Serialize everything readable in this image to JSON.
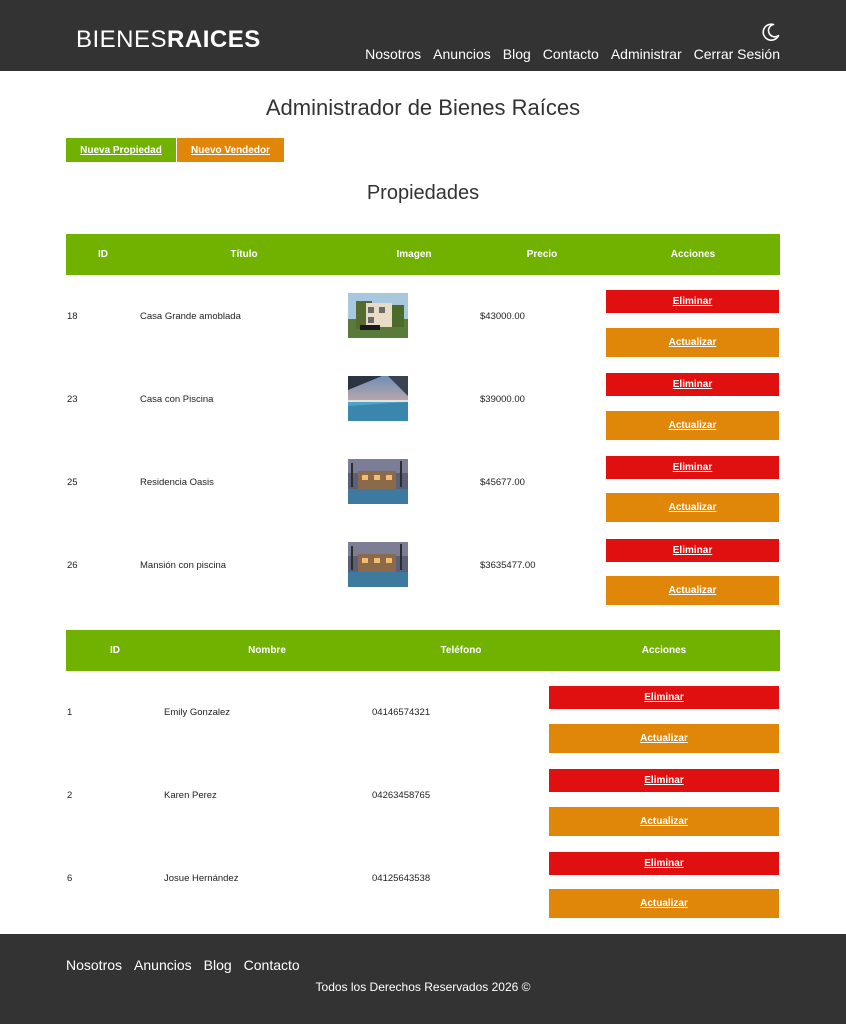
{
  "brand": {
    "light": "BIENES",
    "bold": "RAICES"
  },
  "icons": {
    "theme_toggle": "moon-icon"
  },
  "nav": [
    "Nosotros",
    "Anuncios",
    "Blog",
    "Contacto",
    "Administrar",
    "Cerrar Sesión"
  ],
  "page_title": "Administrador de Bienes Raíces",
  "buttons": {
    "new_property": "Nueva Propiedad",
    "new_seller": "Nuevo Vendedor"
  },
  "properties_title": "Propiedades",
  "properties_table": {
    "headers": [
      "ID",
      "Título",
      "Imagen",
      "Precio",
      "Acciones"
    ],
    "rows": [
      {
        "id": "18",
        "title": "Casa Grande amoblada",
        "price": "$43000.00"
      },
      {
        "id": "23",
        "title": "Casa con Piscina",
        "price": "$39000.00"
      },
      {
        "id": "25",
        "title": "Residencia Oasis",
        "price": "$45677.00"
      },
      {
        "id": "26",
        "title": "Mansión con piscina",
        "price": "$3635477.00"
      }
    ]
  },
  "sellers_table": {
    "headers": [
      "ID",
      "Nombre",
      "Teléfono",
      "Acciones"
    ],
    "rows": [
      {
        "id": "1",
        "name": "Emily Gonzalez",
        "phone": "04146574321"
      },
      {
        "id": "2",
        "name": "Karen Perez",
        "phone": "04263458765"
      },
      {
        "id": "6",
        "name": "Josue Hernández",
        "phone": "04125643538"
      }
    ]
  },
  "actions": {
    "delete": "Eliminar",
    "update": "Actualizar"
  },
  "footer": {
    "nav": [
      "Nosotros",
      "Anuncios",
      "Blog",
      "Contacto"
    ],
    "copyright": "Todos los Derechos Reservados 2026 ©"
  },
  "colors": {
    "header_bg": "#333333",
    "green": "#71b100",
    "orange": "#e08709",
    "red": "#e01010"
  }
}
